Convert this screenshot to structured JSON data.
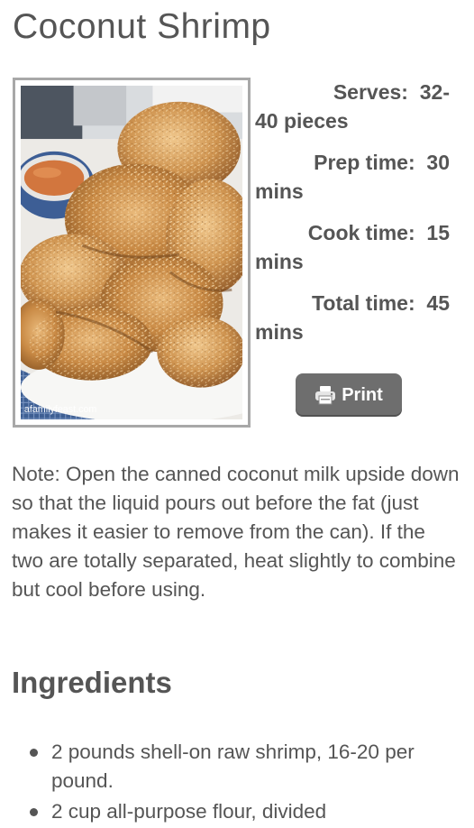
{
  "recipe": {
    "title": "Coconut Shrimp",
    "image_watermark": "afamilyfeast.com",
    "meta": [
      {
        "label": "Serves:",
        "value_start": "32-",
        "value_end": "40 pieces"
      },
      {
        "label": "Prep time:",
        "value_start": "30",
        "value_end": "mins"
      },
      {
        "label": "Cook time:",
        "value_start": "15",
        "value_end": "mins"
      },
      {
        "label": "Total time:",
        "value_start": "45",
        "value_end": "mins"
      }
    ],
    "print_label": "Print",
    "note": "Note: Open the canned coconut milk upside down so that the liquid pours out before the fat (just makes it easier to remove from the can). If the two are totally separated, heat slightly to combine but cool before using.",
    "ingredients_heading": "Ingredients",
    "ingredients": [
      "2 pounds shell-on raw shrimp, 16-20 per pound.",
      "2 cup all-purpose flour, divided"
    ]
  },
  "colors": {
    "text": "#555555",
    "button_bg": "#6e6e6e",
    "frame_border": "#a8a8a8"
  },
  "icons": {
    "print": "printer-icon"
  }
}
